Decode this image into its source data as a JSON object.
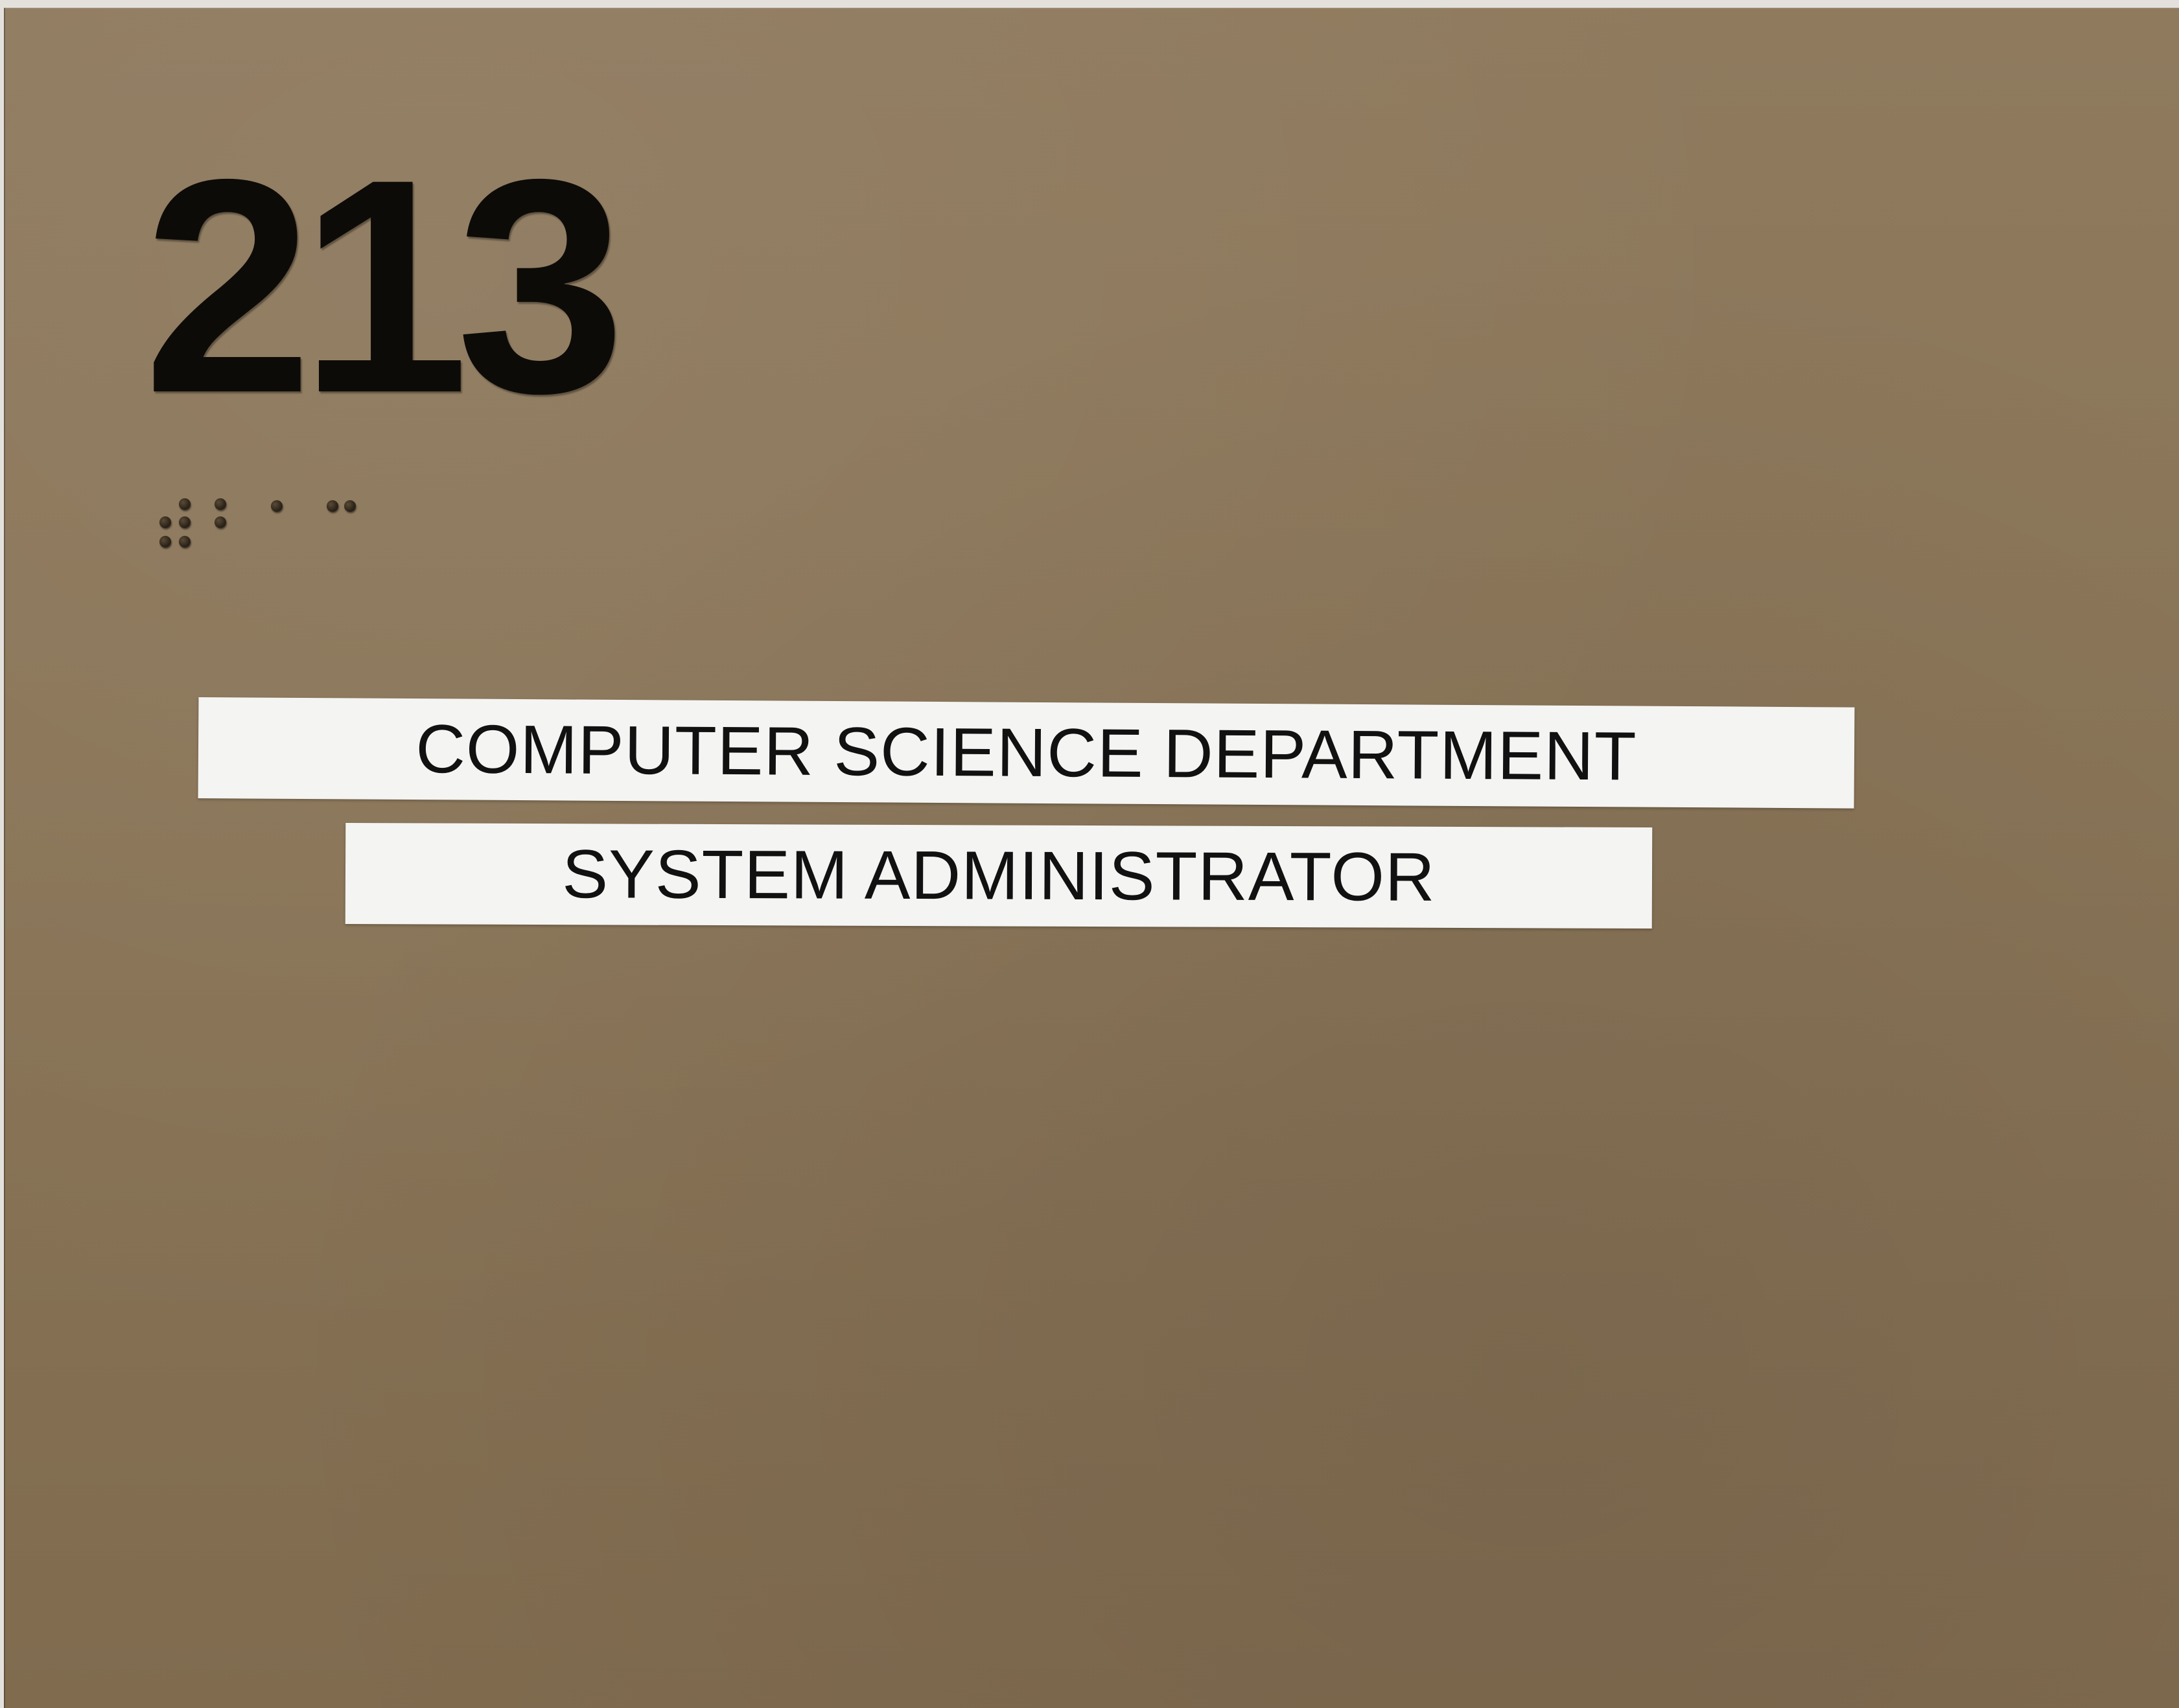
{
  "sign": {
    "room_number": "213",
    "braille_label": "#bac",
    "lines": [
      "COMPUTER SCIENCE DEPARTMENT",
      "SYSTEM ADMINISTRATOR"
    ]
  },
  "colors": {
    "sign_background": "#8a7558",
    "numeral": "#0d0b08",
    "label_background": "#f4f4f2",
    "label_text": "#111111"
  }
}
